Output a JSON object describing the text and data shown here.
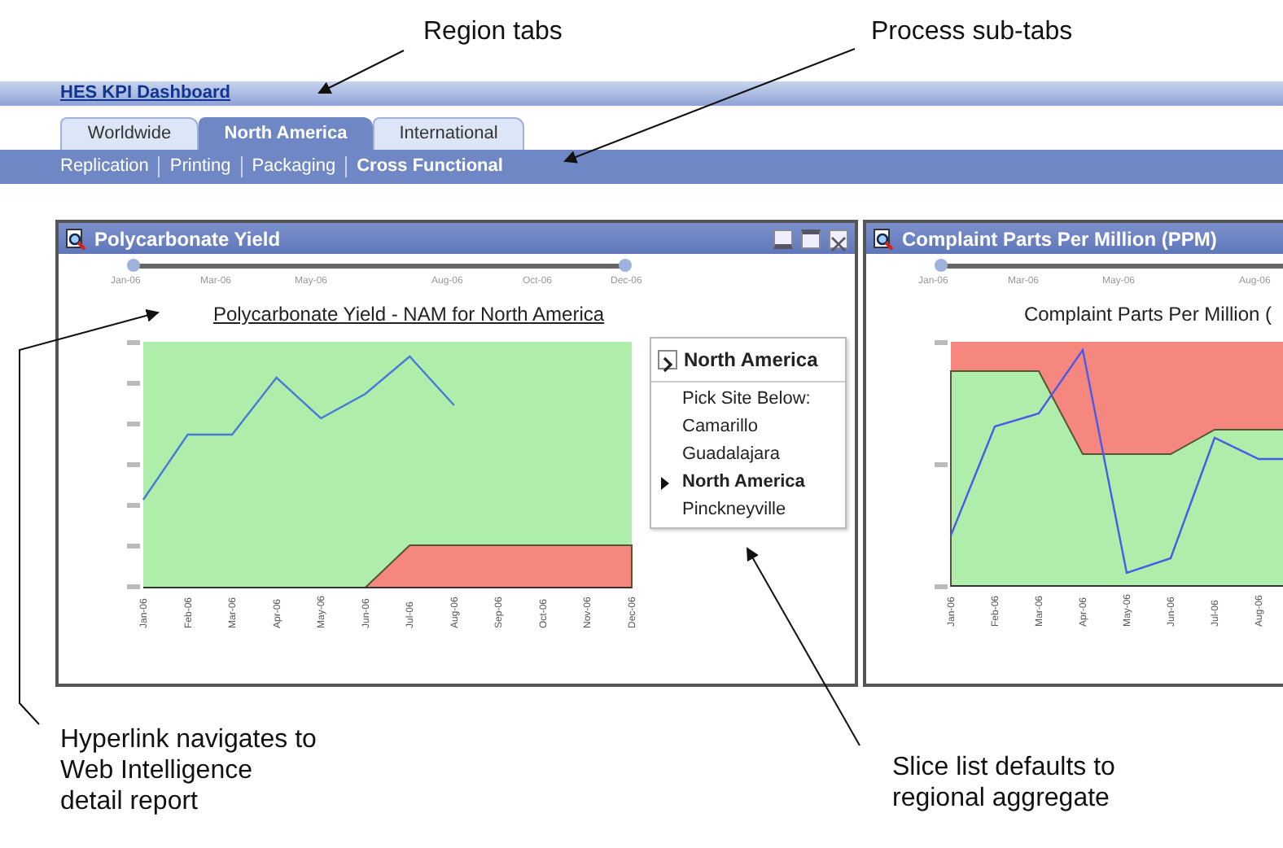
{
  "header": {
    "title": "HES KPI Dashboard"
  },
  "region_tabs": [
    {
      "label": "Worldwide",
      "selected": false
    },
    {
      "label": "North America",
      "selected": true
    },
    {
      "label": "International",
      "selected": false
    }
  ],
  "process_tabs": [
    {
      "label": "Replication",
      "selected": false
    },
    {
      "label": "Printing",
      "selected": false
    },
    {
      "label": "Packaging",
      "selected": false
    },
    {
      "label": "Cross Functional",
      "selected": true
    }
  ],
  "panels": [
    {
      "title": "Polycarbonate Yield",
      "slider_labels": [
        "Jan-06",
        "Mar-06",
        "May-06",
        "Aug-06",
        "Oct-06",
        "Dec-06"
      ],
      "chart_title": "Polycarbonate Yield - NAM for North America",
      "x_labels": [
        "Jan-06",
        "Feb-06",
        "Mar-06",
        "Apr-06",
        "May-06",
        "Jun-06",
        "Jul-06",
        "Aug-06",
        "Sep-06",
        "Oct-06",
        "Nov-06",
        "Dec-06"
      ],
      "slice_list": {
        "header": "North America",
        "prompt": "Pick Site Below:",
        "items": [
          {
            "label": "Camarillo",
            "selected": false
          },
          {
            "label": "Guadalajara",
            "selected": false
          },
          {
            "label": "North America",
            "selected": true
          },
          {
            "label": "Pinckneyville",
            "selected": false
          }
        ]
      }
    },
    {
      "title": "Complaint Parts Per Million (PPM)",
      "slider_labels": [
        "Jan-06",
        "Mar-06",
        "May-06",
        "Aug-06"
      ],
      "chart_title": "Complaint Parts Per Million (",
      "x_labels": [
        "Jan-06",
        "Feb-06",
        "Mar-06",
        "Apr-06",
        "May-06",
        "Jun-06",
        "Jul-06",
        "Aug-06"
      ]
    }
  ],
  "annotations": [
    {
      "text": "Region tabs"
    },
    {
      "text": "Process sub-tabs"
    },
    {
      "text": "Hyperlink navigates to\nWeb Intelligence\ndetail report"
    },
    {
      "text": "Slice list defaults to\nregional aggregate"
    }
  ]
}
